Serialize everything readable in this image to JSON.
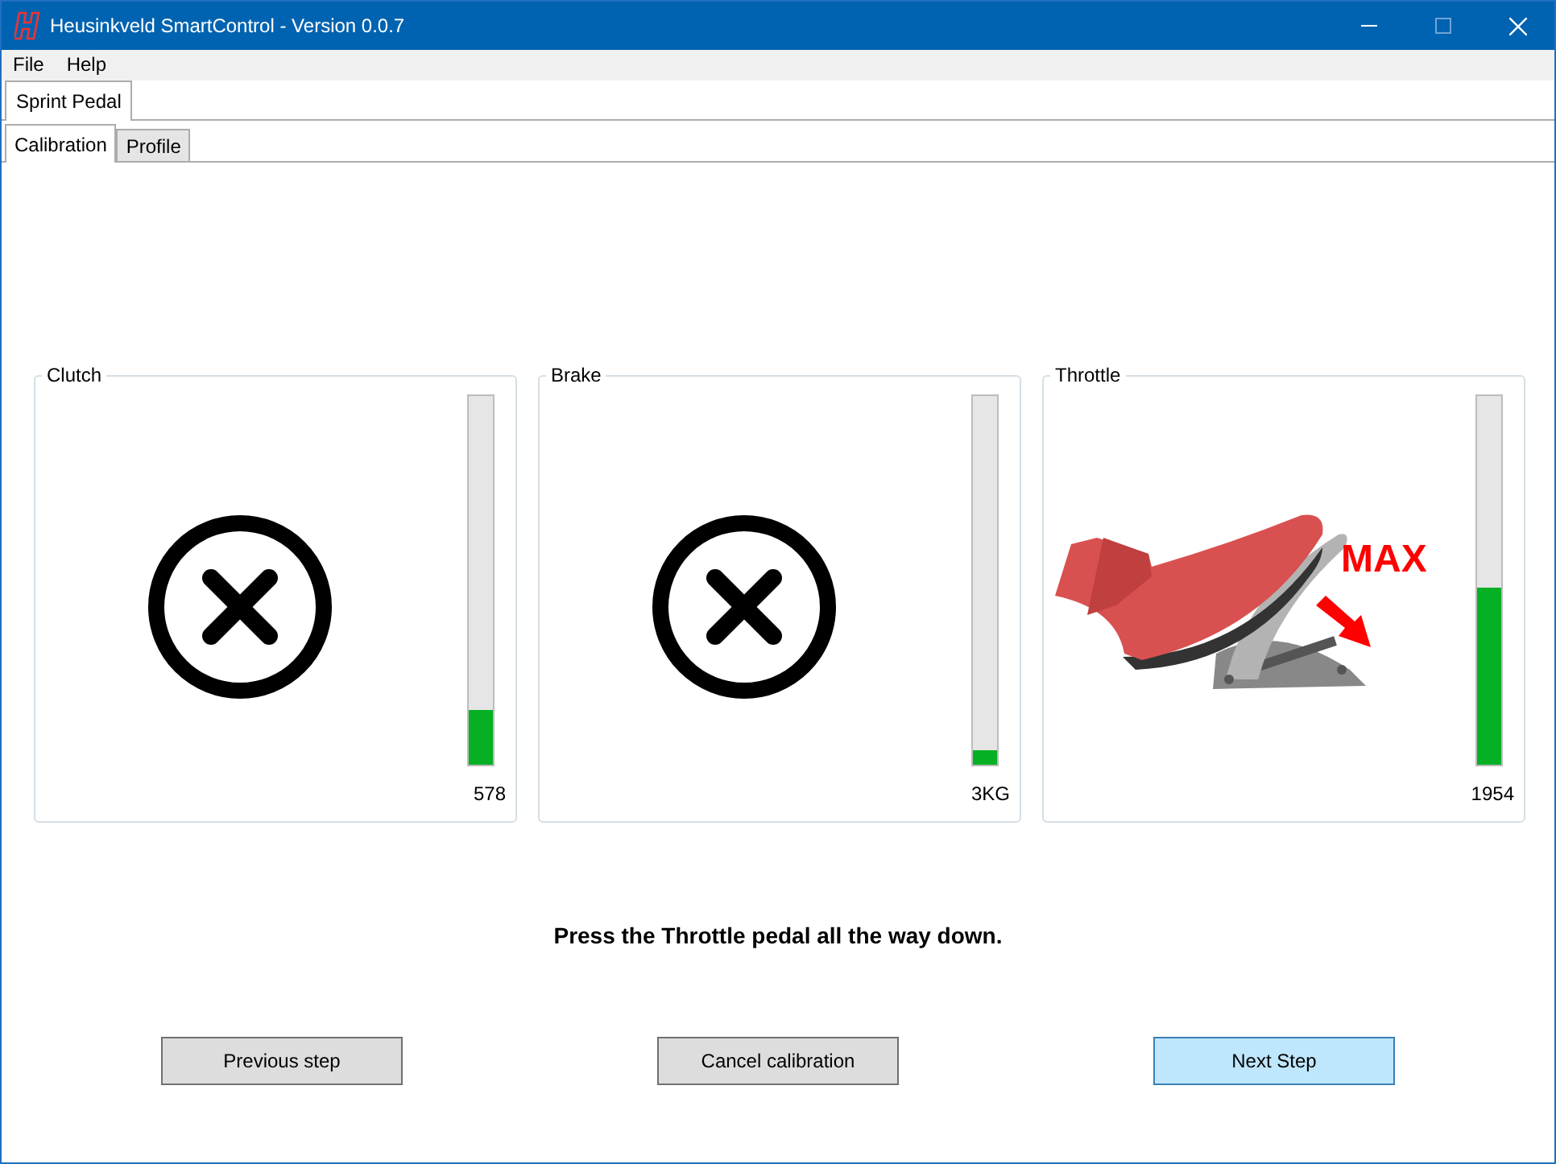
{
  "window": {
    "title": "Heusinkveld SmartControl - Version 0.0.7"
  },
  "menu": [
    "File",
    "Help"
  ],
  "device_tabs": [
    {
      "label": "Sprint Pedal",
      "selected": true
    }
  ],
  "tabs": [
    {
      "label": "Calibration",
      "selected": true
    },
    {
      "label": "Profile",
      "selected": false
    }
  ],
  "pedals": [
    {
      "name": "Clutch",
      "kind": "error",
      "level": 0.15,
      "reading": "578"
    },
    {
      "name": "Brake",
      "kind": "error",
      "level": 0.04,
      "reading": "3KG"
    },
    {
      "name": "Throttle",
      "kind": "press",
      "hint": "MAX",
      "level": 0.48,
      "reading": "1954"
    }
  ],
  "instruction": "Press the Throttle pedal all the way down.",
  "buttons": [
    {
      "label": "Previous step",
      "primary": false
    },
    {
      "label": "Cancel calibration",
      "primary": false
    },
    {
      "label": "Next Step",
      "primary": true
    }
  ]
}
